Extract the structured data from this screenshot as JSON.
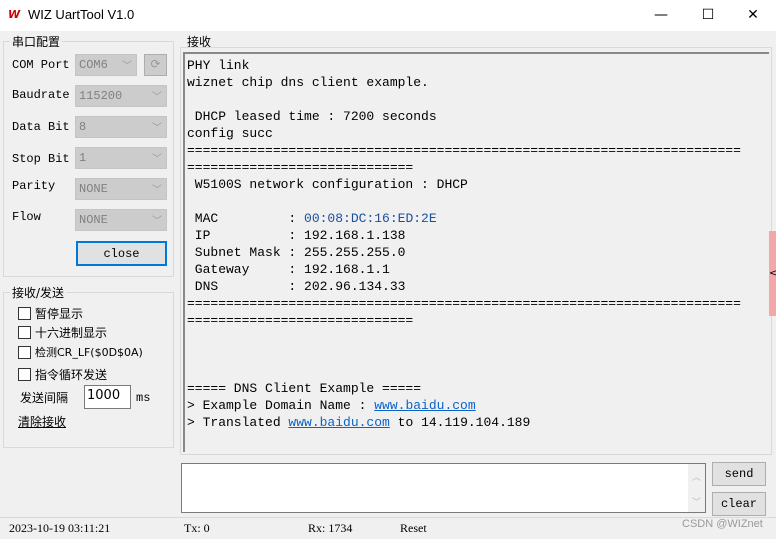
{
  "window": {
    "title": "WIZ UartTool V1.0",
    "logo": "W",
    "minimize": "—",
    "maximize": "☐",
    "close": "✕"
  },
  "serial": {
    "group_label": "串口配置",
    "com_port": {
      "label": "COM Port",
      "value": "COM6"
    },
    "baudrate": {
      "label": "Baudrate",
      "value": "115200"
    },
    "data_bit": {
      "label": "Data Bit",
      "value": "8"
    },
    "stop_bit": {
      "label": "Stop Bit",
      "value": "1"
    },
    "parity": {
      "label": "Parity",
      "value": "NONE"
    },
    "flow": {
      "label": "Flow",
      "value": "NONE"
    },
    "refresh_icon": "refresh-icon",
    "close_label": "close"
  },
  "rxtx": {
    "group_label": "接收/发送",
    "checkboxes": [
      "暂停显示",
      "十六进制显示",
      "检测CR_LF($0D$0A)",
      "指令循环发送"
    ],
    "interval_label": "发送间隔",
    "interval_value": "1000",
    "interval_unit": "ms",
    "clear_receive": "清除接收"
  },
  "receive": {
    "group_label": "接收",
    "lines": [
      "PHY link",
      "wiznet chip dns client example.",
      "",
      " DHCP leased time : 7200 seconds",
      "config succ",
      "=======================================================================",
      "=============================",
      " W5100S network configuration : DHCP",
      ""
    ],
    "config": [
      {
        "key": " MAC         : ",
        "value": "00:08:DC:16:ED:2E"
      },
      {
        "key": " IP          : ",
        "value": "192.168.1.138"
      },
      {
        "key": " Subnet Mask : ",
        "value": "255.255.255.0"
      },
      {
        "key": " Gateway     : ",
        "value": "192.168.1.1"
      },
      {
        "key": " DNS         : ",
        "value": "202.96.134.33"
      }
    ],
    "sep1": "=======================================================================",
    "sep2": "=============================",
    "dns_header": "===== DNS Client Example =====",
    "domain_prefix": "> Example Domain Name : ",
    "domain": "www.baidu.com",
    "translated_prefix": "> Translated ",
    "translated_domain": "www.baidu.com",
    "translated_mid": " to ",
    "translated_ip": "14.119.104.189"
  },
  "send": {
    "input_value": "",
    "send_label": "send",
    "clear_label": "clear"
  },
  "statusbar": {
    "datetime": "2023-10-19 03:11:21",
    "tx": "Tx: 0",
    "rx": "Rx: 1734",
    "reset": "Reset",
    "watermark": "CSDN @WIZnet"
  },
  "side_handle": "<"
}
